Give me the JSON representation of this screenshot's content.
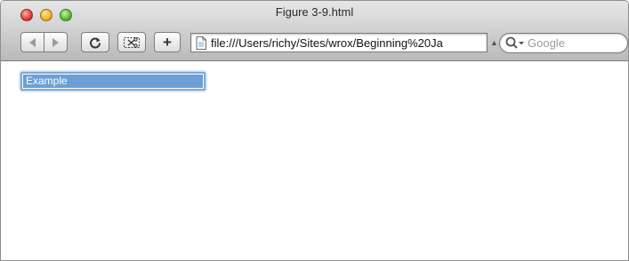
{
  "window": {
    "title": "Figure 3-9.html"
  },
  "toolbar": {
    "reload_icon": "reload-icon",
    "snip_icon": "clip-icon",
    "add_label": "+",
    "back_icon": "back-arrow-icon",
    "forward_icon": "forward-arrow-icon"
  },
  "address": {
    "url": "file:///Users/richy/Sites/wrox/Beginning%20Ja"
  },
  "search": {
    "placeholder": "Google"
  },
  "content": {
    "input_value": "Example"
  }
}
